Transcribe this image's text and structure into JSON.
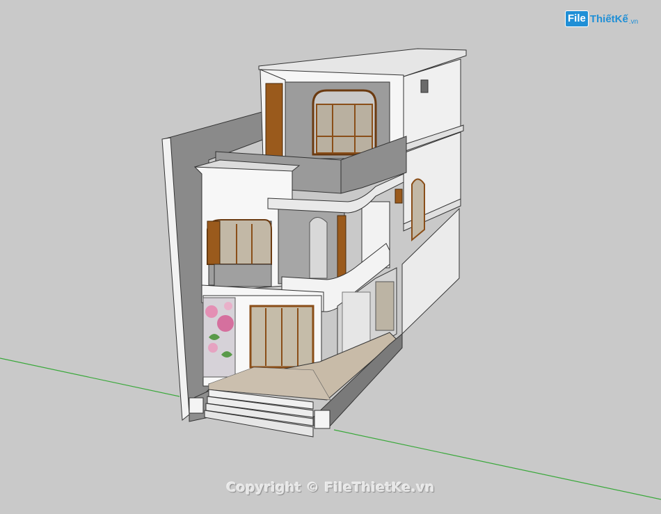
{
  "watermark": {
    "logo_box": "File",
    "logo_rest": "ThiếtKế",
    "logo_ext": ".vn",
    "copyright": "Copyright © FileThietKe.vn"
  },
  "colors": {
    "background": "#c9c9c9",
    "wall_white": "#f4f4f4",
    "wall_gray": "#8f8f8f",
    "concrete": "#a3a3a3",
    "wood": "#9a5a1c",
    "floor": "#c8bba8",
    "green_axis": "#39a83a",
    "logo_blue": "#1f8fd6"
  }
}
